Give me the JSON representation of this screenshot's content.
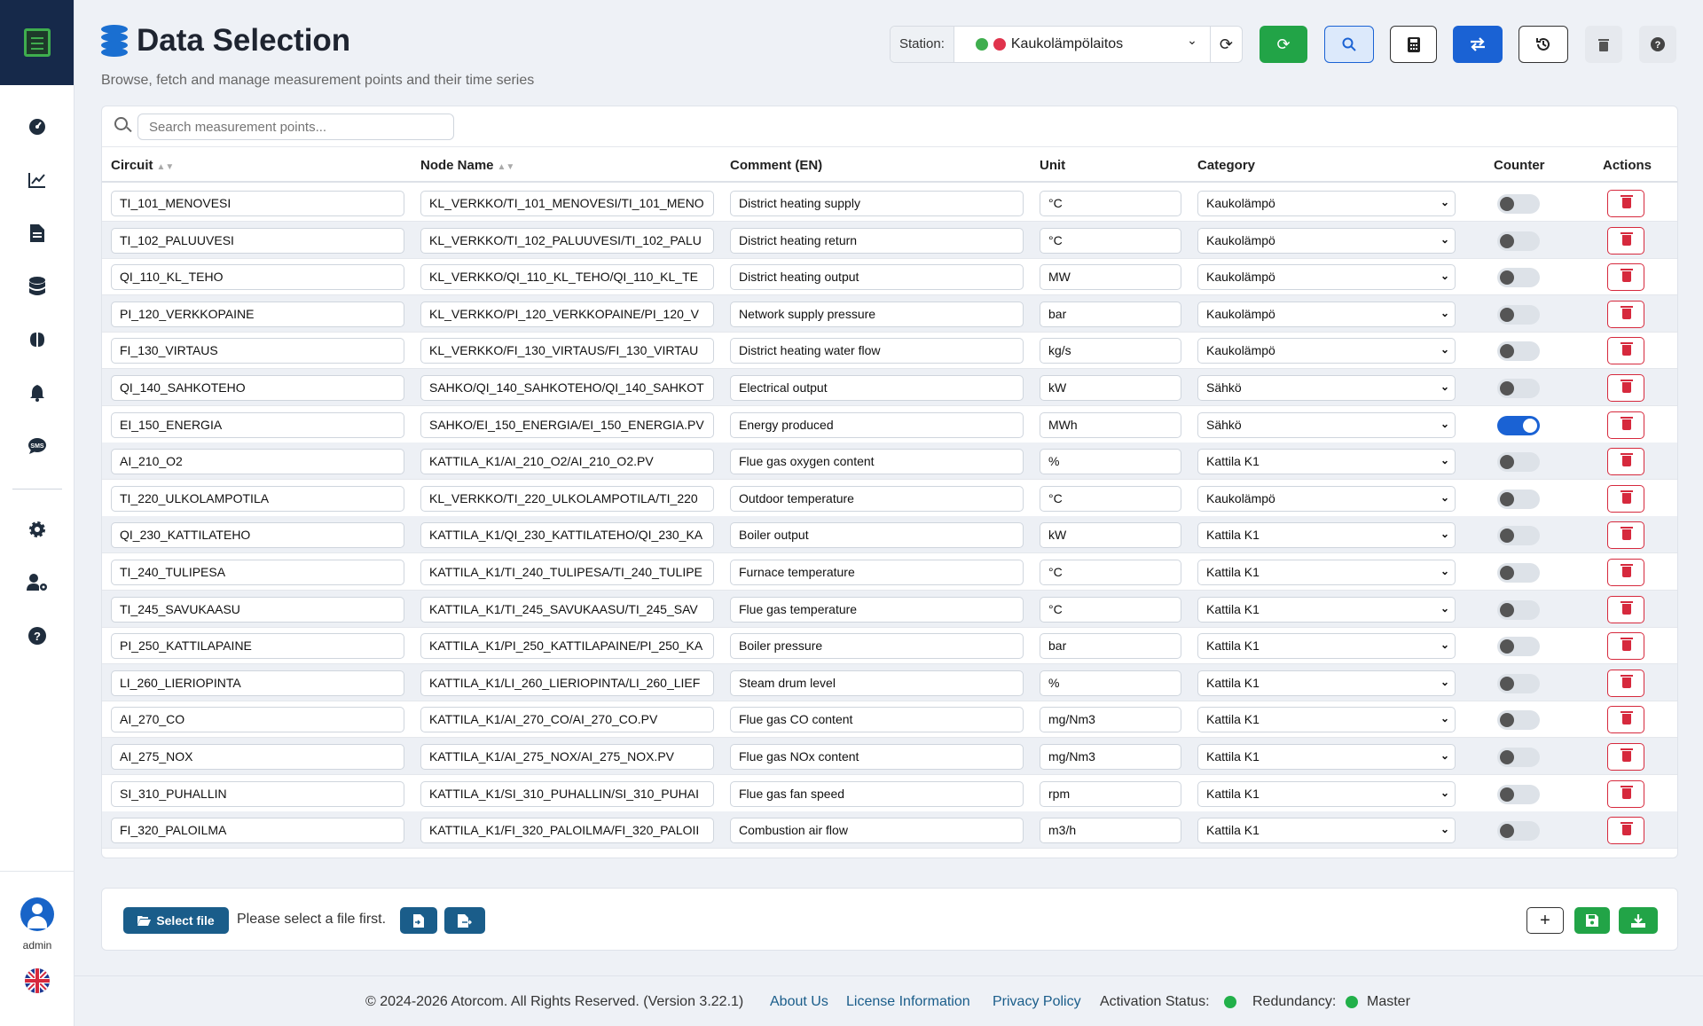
{
  "page": {
    "title": "Data Selection",
    "subtitle": "Browse, fetch and manage measurement points and their time series"
  },
  "station": {
    "label": "Station:",
    "value": "Kaukolämpölaitos",
    "status_colors": [
      "#3fae4e",
      "#e0334c"
    ]
  },
  "search": {
    "placeholder": "Search measurement points..."
  },
  "columns": {
    "circuit": "Circuit",
    "node": "Node Name",
    "comment": "Comment (EN)",
    "unit": "Unit",
    "category": "Category",
    "counter": "Counter",
    "actions": "Actions"
  },
  "rows": [
    {
      "circuit": "TI_101_MENOVESI",
      "node": "KL_VERKKO/TI_101_MENOVESI/TI_101_MENO",
      "comment": "District heating supply",
      "unit": "°C",
      "category": "Kaukolämpö",
      "counter": false
    },
    {
      "circuit": "TI_102_PALUUVESI",
      "node": "KL_VERKKO/TI_102_PALUUVESI/TI_102_PALU",
      "comment": "District heating return",
      "unit": "°C",
      "category": "Kaukolämpö",
      "counter": false
    },
    {
      "circuit": "QI_110_KL_TEHO",
      "node": "KL_VERKKO/QI_110_KL_TEHO/QI_110_KL_TE",
      "comment": "District heating output",
      "unit": "MW",
      "category": "Kaukolämpö",
      "counter": false
    },
    {
      "circuit": "PI_120_VERKKOPAINE",
      "node": "KL_VERKKO/PI_120_VERKKOPAINE/PI_120_V",
      "comment": "Network supply pressure",
      "unit": "bar",
      "category": "Kaukolämpö",
      "counter": false
    },
    {
      "circuit": "FI_130_VIRTAUS",
      "node": "KL_VERKKO/FI_130_VIRTAUS/FI_130_VIRTAU",
      "comment": "District heating water flow",
      "unit": "kg/s",
      "category": "Kaukolämpö",
      "counter": false
    },
    {
      "circuit": "QI_140_SAHKOTEHO",
      "node": "SAHKO/QI_140_SAHKOTEHO/QI_140_SAHKOT",
      "comment": "Electrical output",
      "unit": "kW",
      "category": "Sähkö",
      "counter": false
    },
    {
      "circuit": "EI_150_ENERGIA",
      "node": "SAHKO/EI_150_ENERGIA/EI_150_ENERGIA.PV",
      "comment": "Energy produced",
      "unit": "MWh",
      "category": "Sähkö",
      "counter": true
    },
    {
      "circuit": "AI_210_O2",
      "node": "KATTILA_K1/AI_210_O2/AI_210_O2.PV",
      "comment": "Flue gas oxygen content",
      "unit": "%",
      "category": "Kattila K1",
      "counter": false
    },
    {
      "circuit": "TI_220_ULKOLAMPOTILA",
      "node": "KL_VERKKO/TI_220_ULKOLAMPOTILA/TI_220",
      "comment": "Outdoor temperature",
      "unit": "°C",
      "category": "Kaukolämpö",
      "counter": false
    },
    {
      "circuit": "QI_230_KATTILATEHO",
      "node": "KATTILA_K1/QI_230_KATTILATEHO/QI_230_KA",
      "comment": "Boiler output",
      "unit": "kW",
      "category": "Kattila K1",
      "counter": false
    },
    {
      "circuit": "TI_240_TULIPESA",
      "node": "KATTILA_K1/TI_240_TULIPESA/TI_240_TULIPE",
      "comment": "Furnace temperature",
      "unit": "°C",
      "category": "Kattila K1",
      "counter": false
    },
    {
      "circuit": "TI_245_SAVUKAASU",
      "node": "KATTILA_K1/TI_245_SAVUKAASU/TI_245_SAV",
      "comment": "Flue gas temperature",
      "unit": "°C",
      "category": "Kattila K1",
      "counter": false
    },
    {
      "circuit": "PI_250_KATTILAPAINE",
      "node": "KATTILA_K1/PI_250_KATTILAPAINE/PI_250_KA",
      "comment": "Boiler pressure",
      "unit": "bar",
      "category": "Kattila K1",
      "counter": false
    },
    {
      "circuit": "LI_260_LIERIOPINTA",
      "node": "KATTILA_K1/LI_260_LIERIOPINTA/LI_260_LIEF",
      "comment": "Steam drum level",
      "unit": "%",
      "category": "Kattila K1",
      "counter": false
    },
    {
      "circuit": "AI_270_CO",
      "node": "KATTILA_K1/AI_270_CO/AI_270_CO.PV",
      "comment": "Flue gas CO content",
      "unit": "mg/Nm3",
      "category": "Kattila K1",
      "counter": false
    },
    {
      "circuit": "AI_275_NOX",
      "node": "KATTILA_K1/AI_275_NOX/AI_275_NOX.PV",
      "comment": "Flue gas NOx content",
      "unit": "mg/Nm3",
      "category": "Kattila K1",
      "counter": false
    },
    {
      "circuit": "SI_310_PUHALLIN",
      "node": "KATTILA_K1/SI_310_PUHALLIN/SI_310_PUHAI",
      "comment": "Flue gas fan speed",
      "unit": "rpm",
      "category": "Kattila K1",
      "counter": false
    },
    {
      "circuit": "FI_320_PALOILMA",
      "node": "KATTILA_K1/FI_320_PALOILMA/FI_320_PALOII",
      "comment": "Combustion air flow",
      "unit": "m3/h",
      "category": "Kattila K1",
      "counter": false
    }
  ],
  "file": {
    "select_label": "Select file",
    "message": "Please select a file first."
  },
  "user": {
    "name": "admin"
  },
  "footer": {
    "copyright": "© 2024-2026 Atorcom. All Rights Reserved. (Version 3.22.1)",
    "about": "About Us",
    "license": "License Information",
    "privacy": "Privacy Policy",
    "activation_label": "Activation Status:",
    "redundancy_label": "Redundancy:",
    "redundancy_value": "Master"
  },
  "colors": {
    "primary": "#1a62d4",
    "green": "#22a447",
    "danger": "#d6293d",
    "sidebar_top": "#16294a"
  }
}
